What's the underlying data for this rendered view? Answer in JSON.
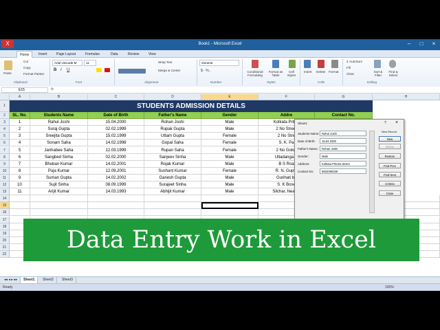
{
  "window": {
    "title": "Book1 - Microsoft Excel"
  },
  "ribbon_tabs": [
    "Home",
    "Insert",
    "Page Layout",
    "Formulas",
    "Data",
    "Review",
    "View"
  ],
  "clipboard": {
    "paste": "Paste",
    "cut": "Cut",
    "copy": "Copy",
    "format_painter": "Format Painter",
    "group": "Clipboard"
  },
  "font": {
    "name": "Arial Unicode M",
    "size": "11",
    "group": "Font"
  },
  "alignment": {
    "wrap": "Wrap Text",
    "merge": "Merge & Center",
    "group": "Alignment"
  },
  "number": {
    "format": "General",
    "group": "Number"
  },
  "styles": {
    "conditional": "Conditional Formatting",
    "format_table": "Format as Table",
    "cell_styles": "Cell Styles",
    "group": "Styles"
  },
  "cells": {
    "insert": "Insert",
    "delete": "Delete",
    "format": "Format",
    "group": "Cells"
  },
  "editing": {
    "autosum": "AutoSum",
    "fill": "Fill",
    "clear": "Clear",
    "sort": "Sort & Filter",
    "find": "Find & Select",
    "group": "Editing"
  },
  "formula_bar": {
    "name_box": "E15",
    "fx": "fx"
  },
  "columns": [
    "A",
    "B",
    "C",
    "D",
    "E",
    "F",
    "G",
    "H"
  ],
  "sheet": {
    "title": "STUDENTS ADMISSION DETAILS",
    "headers": [
      "SL. No.",
      "Students Name",
      "Date of Birth",
      "Father's Name",
      "Gender",
      "Addre",
      "Contact No."
    ],
    "rows": [
      [
        "1",
        "Rahul Joshi",
        "15.04.2000",
        "Rohan Joshi",
        "Male",
        "Kolkata Pritori"
      ],
      [
        "2",
        "Suraj Gupta",
        "02.02.1999",
        "Rupak Gupta",
        "Male",
        "2 No Street"
      ],
      [
        "3",
        "Sreejita Gupta",
        "15.02.1999",
        "Uttam Gupta",
        "Female",
        "2 No Stre"
      ],
      [
        "4",
        "Sonam Saha",
        "14.02.1998",
        "Gopal Saha",
        "Female",
        "S. K. Pa"
      ],
      [
        "5",
        "Janhabee Saha",
        "12.03.1999",
        "Rupan Saha",
        "Female",
        "2 No Golok"
      ],
      [
        "6",
        "Sangbed Sinha",
        "02.02.2000",
        "Sanjeev Sinha",
        "Male",
        "Ultadanga C"
      ],
      [
        "7",
        "Bhuban Kumar",
        "14.02.2001",
        "Rojak Kumar",
        "Male",
        "B S Roa"
      ],
      [
        "8",
        "Puja Kumar",
        "12.09.2001",
        "Sushant Kumar",
        "Female",
        "R. N. Gupta"
      ],
      [
        "9",
        "Suman Gupta",
        "14.02.2002",
        "Ganesh Gupta",
        "Male",
        "Gurihati by"
      ],
      [
        "10",
        "Sujit Sinha",
        "08.09.1999",
        "Surajeet Sinha",
        "Male",
        "S. K Bose"
      ],
      [
        "11",
        "Arijit Kumar",
        "14.03.1993",
        "Abhijit Kumar",
        "Male",
        "Silchar, Near N"
      ]
    ],
    "row_numbers": [
      "1",
      "2",
      "3",
      "4",
      "5",
      "6",
      "7",
      "8",
      "9",
      "10",
      "11",
      "12",
      "13",
      "14",
      "15",
      "16",
      "17",
      "18",
      "19",
      "20",
      "21",
      "22"
    ]
  },
  "dialog": {
    "title": "Sheet1",
    "help": "?",
    "close": "×",
    "record_status": "New Record",
    "fields": [
      {
        "label": "Students Name:",
        "value": "Rahul Joshi"
      },
      {
        "label": "Date of Birth:",
        "value": "15.04.2000"
      },
      {
        "label": "Father's Name:",
        "value": "Rohan Joshi"
      },
      {
        "label": "Gender:",
        "value": "Male"
      },
      {
        "label": "Address:",
        "value": "Kolkata Pritoria Street"
      },
      {
        "label": "Contact No:",
        "value": "9832090335"
      }
    ],
    "buttons": [
      "New",
      "Delete",
      "Restore",
      "Find Prev",
      "Find Next",
      "Criteria",
      "Close"
    ]
  },
  "banner": {
    "text": "Data Entry Work in Excel",
    "color": "#1e9a3a"
  },
  "sheet_tabs": [
    "Sheet1",
    "Sheet2",
    "Sheet3"
  ],
  "status": {
    "ready": "Ready",
    "zoom": "100%"
  }
}
